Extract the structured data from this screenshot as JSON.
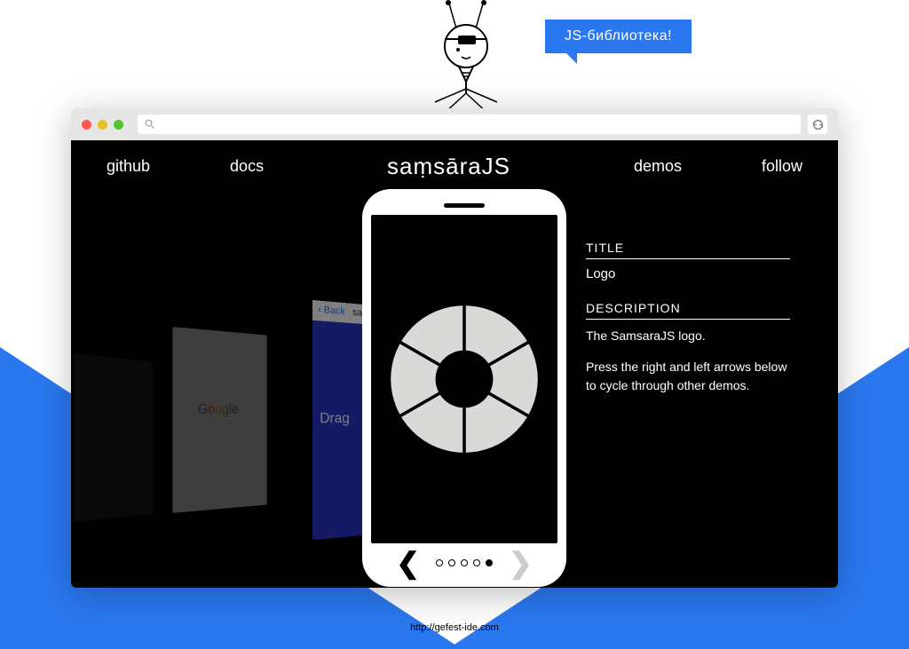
{
  "bubble": {
    "text": "JS-библиотека!"
  },
  "footer": {
    "url": "http://gefest-ide.com"
  },
  "browser": {
    "search_placeholder": ""
  },
  "nav": {
    "left": [
      "github",
      "docs"
    ],
    "logo": "saṃsāraJS",
    "right": [
      "demos",
      "follow"
    ]
  },
  "info": {
    "title_label": "TITLE",
    "title_value": "Logo",
    "desc_label": "DESCRIPTION",
    "desc_text1": "The SamsaraJS logo.",
    "desc_text2": "Press the right and left arrows below to cycle through other demos."
  },
  "carousel": {
    "back_label": "Back",
    "back_tab": "sam",
    "drag_label": "Drag",
    "dots_total": 5,
    "dots_active_index": 4
  }
}
